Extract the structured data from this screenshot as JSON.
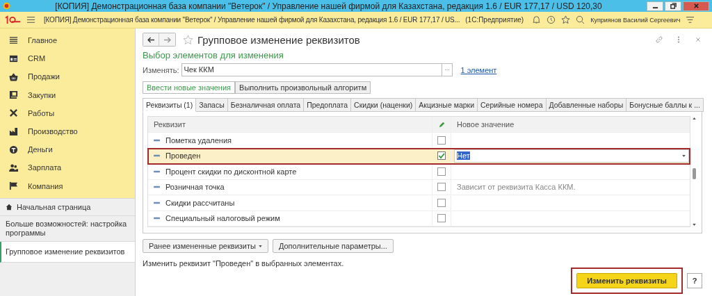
{
  "window": {
    "title": "[КОПИЯ] Демонстрационная база компании \"Ветерок\" / Управление нашей фирмой для Казахстана, редакция 1.6 / EUR 177,17 / USD 120,30"
  },
  "app_bar": {
    "title": "[КОПИЯ] Демонстрационная база компании \"Ветерок\" / Управление нашей фирмой для Казахстана, редакция 1.6 / EUR 177,17 / US...",
    "app": "(1С:Предприятие)",
    "user": "Куприянов Василий Сергеевич"
  },
  "sidebar": {
    "sections": [
      {
        "label": "Главное"
      },
      {
        "label": "CRM"
      },
      {
        "label": "Продажи"
      },
      {
        "label": "Закупки"
      },
      {
        "label": "Работы"
      },
      {
        "label": "Производство"
      },
      {
        "label": "Деньги"
      },
      {
        "label": "Зарплата"
      },
      {
        "label": "Компания"
      }
    ],
    "home": "Начальная страница",
    "open_items": [
      {
        "label": "Больше возможностей: настройка программы",
        "selected": false
      },
      {
        "label": "Групповое изменение реквизитов",
        "selected": true
      }
    ]
  },
  "form": {
    "title": "Групповое изменение реквизитов",
    "subtitle": "Выбор элементов для изменения",
    "change_label": "Изменять:",
    "change_value": "Чек ККМ",
    "link": "1 элемент",
    "modes": [
      {
        "label": "Ввести новые значения",
        "selected": true
      },
      {
        "label": "Выполнить произвольный алгоритм",
        "selected": false
      }
    ],
    "tabs": [
      {
        "label": "Реквизиты (1)",
        "selected": true
      },
      {
        "label": "Запасы",
        "selected": false
      },
      {
        "label": "Безналичная оплата",
        "selected": false
      },
      {
        "label": "Предоплата",
        "selected": false
      },
      {
        "label": "Скидки (наценки)",
        "selected": false
      },
      {
        "label": "Акцизные марки",
        "selected": false
      },
      {
        "label": "Серийные номера",
        "selected": false
      },
      {
        "label": "Добавленные наборы",
        "selected": false
      },
      {
        "label": "Бонусные баллы к ...",
        "selected": false
      }
    ],
    "columns": [
      "Реквизит",
      "Новое значение"
    ],
    "rows": [
      {
        "name": "Пометка удаления",
        "checked": false,
        "selected": false
      },
      {
        "name": "Проведен",
        "checked": true,
        "selected": true,
        "value": "Нет"
      },
      {
        "name": "Процент скидки по дисконтной карте",
        "checked": false,
        "selected": false
      },
      {
        "name": "Розничная точка",
        "checked": false,
        "selected": false,
        "value": "Зависит от реквизита Касса ККМ."
      },
      {
        "name": "Скидки рассчитаны",
        "checked": false,
        "selected": false
      },
      {
        "name": "Специальный налоговый режим",
        "checked": false,
        "selected": false
      }
    ],
    "buttons": [
      "Ранее измененные реквизиты",
      "Дополнительные параметры..."
    ],
    "hint": "Изменить реквизит \"Проведен\" в выбранных элементах.",
    "primary": {
      "label": "Изменить реквизиты",
      "highlighted": true
    },
    "help": "?"
  }
}
